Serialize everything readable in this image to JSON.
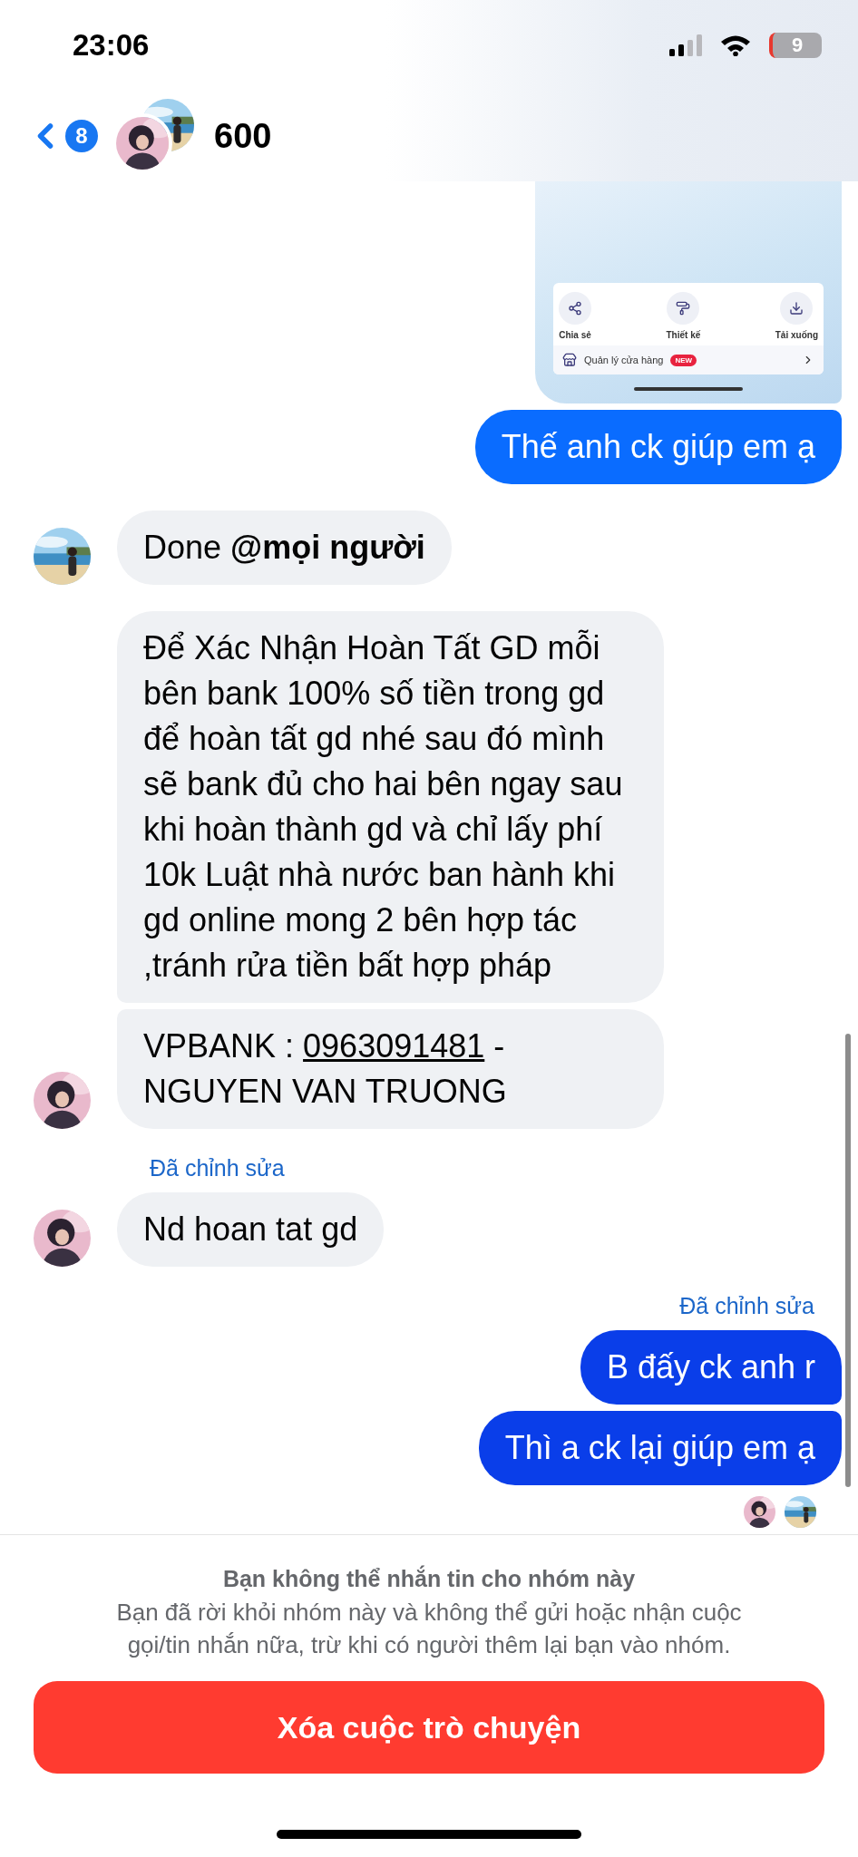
{
  "status_bar": {
    "time": "23:06",
    "battery": "9"
  },
  "header": {
    "back_badge": "8",
    "avatars": [
      {
        "kind": "beach"
      },
      {
        "kind": "portrait"
      }
    ],
    "title": "600"
  },
  "groups": [
    {
      "kind": "outgoing",
      "messages": [
        {
          "actions": [
            {
              "label": "Chia sẻ"
            },
            {
              "label": "Thiết kế"
            },
            {
              "label": "Tải xuống"
            }
          ],
          "store_row": {
            "label": "Quản lý cửa hàng",
            "badge": "NEW"
          }
        },
        {
          "kind": "text",
          "text": "Thế anh ck giúp em ạ",
          "color": "#0a6cff"
        }
      ]
    },
    {
      "kind": "incoming",
      "avatar": {
        "kind": "beach"
      },
      "messages": [
        {
          "kind": "text",
          "text": "Done **@mọi người**"
        }
      ]
    },
    {
      "kind": "incoming",
      "avatar": {
        "kind": "portrait"
      },
      "messages": [
        {
          "kind": "text",
          "text": "Để Xác Nhận Hoàn Tất GD mỗi bên bank 100% số tiền trong gd để hoàn tất gd nhé sau đó mình sẽ bank đủ cho hai bên ngay sau khi hoàn thành gd và chỉ lấy phí 10k Luật nhà nước ban hành khi gd online mong 2 bên hợp tác ,tránh rửa tiền bất hợp pháp"
        },
        {
          "kind": "text",
          "text": "VPBANK : ",
          "link": "0963091481",
          "text_after": " - NGUYEN VAN TRUONG"
        }
      ]
    },
    {
      "kind": "incoming",
      "avatar": {
        "kind": "portrait"
      },
      "edited_label": "Đã chỉnh sửa",
      "messages": [
        {
          "kind": "text",
          "text": "Nd hoan tat gd"
        }
      ]
    },
    {
      "kind": "outgoing",
      "edited_label": "Đã chỉnh sửa",
      "messages": [
        {
          "kind": "text",
          "text": "B đấy ck anh r",
          "color": "#0a3ee9"
        },
        {
          "kind": "text",
          "text": "Thì a ck lại giúp em ạ",
          "color": "#0a3ee9"
        }
      ]
    }
  ],
  "read_by": [
    {
      "kind": "portrait"
    },
    {
      "kind": "beach"
    }
  ],
  "notice": {
    "title": "Bạn không thể nhắn tin cho nhóm này",
    "body": "Bạn đã rời khỏi nhóm này và không thể gửi hoặc nhận cuộc gọi/tin nhắn nữa, trừ khi có người thêm lại bạn vào nhóm."
  },
  "delete_button": "Xóa cuộc trò chuyện"
}
